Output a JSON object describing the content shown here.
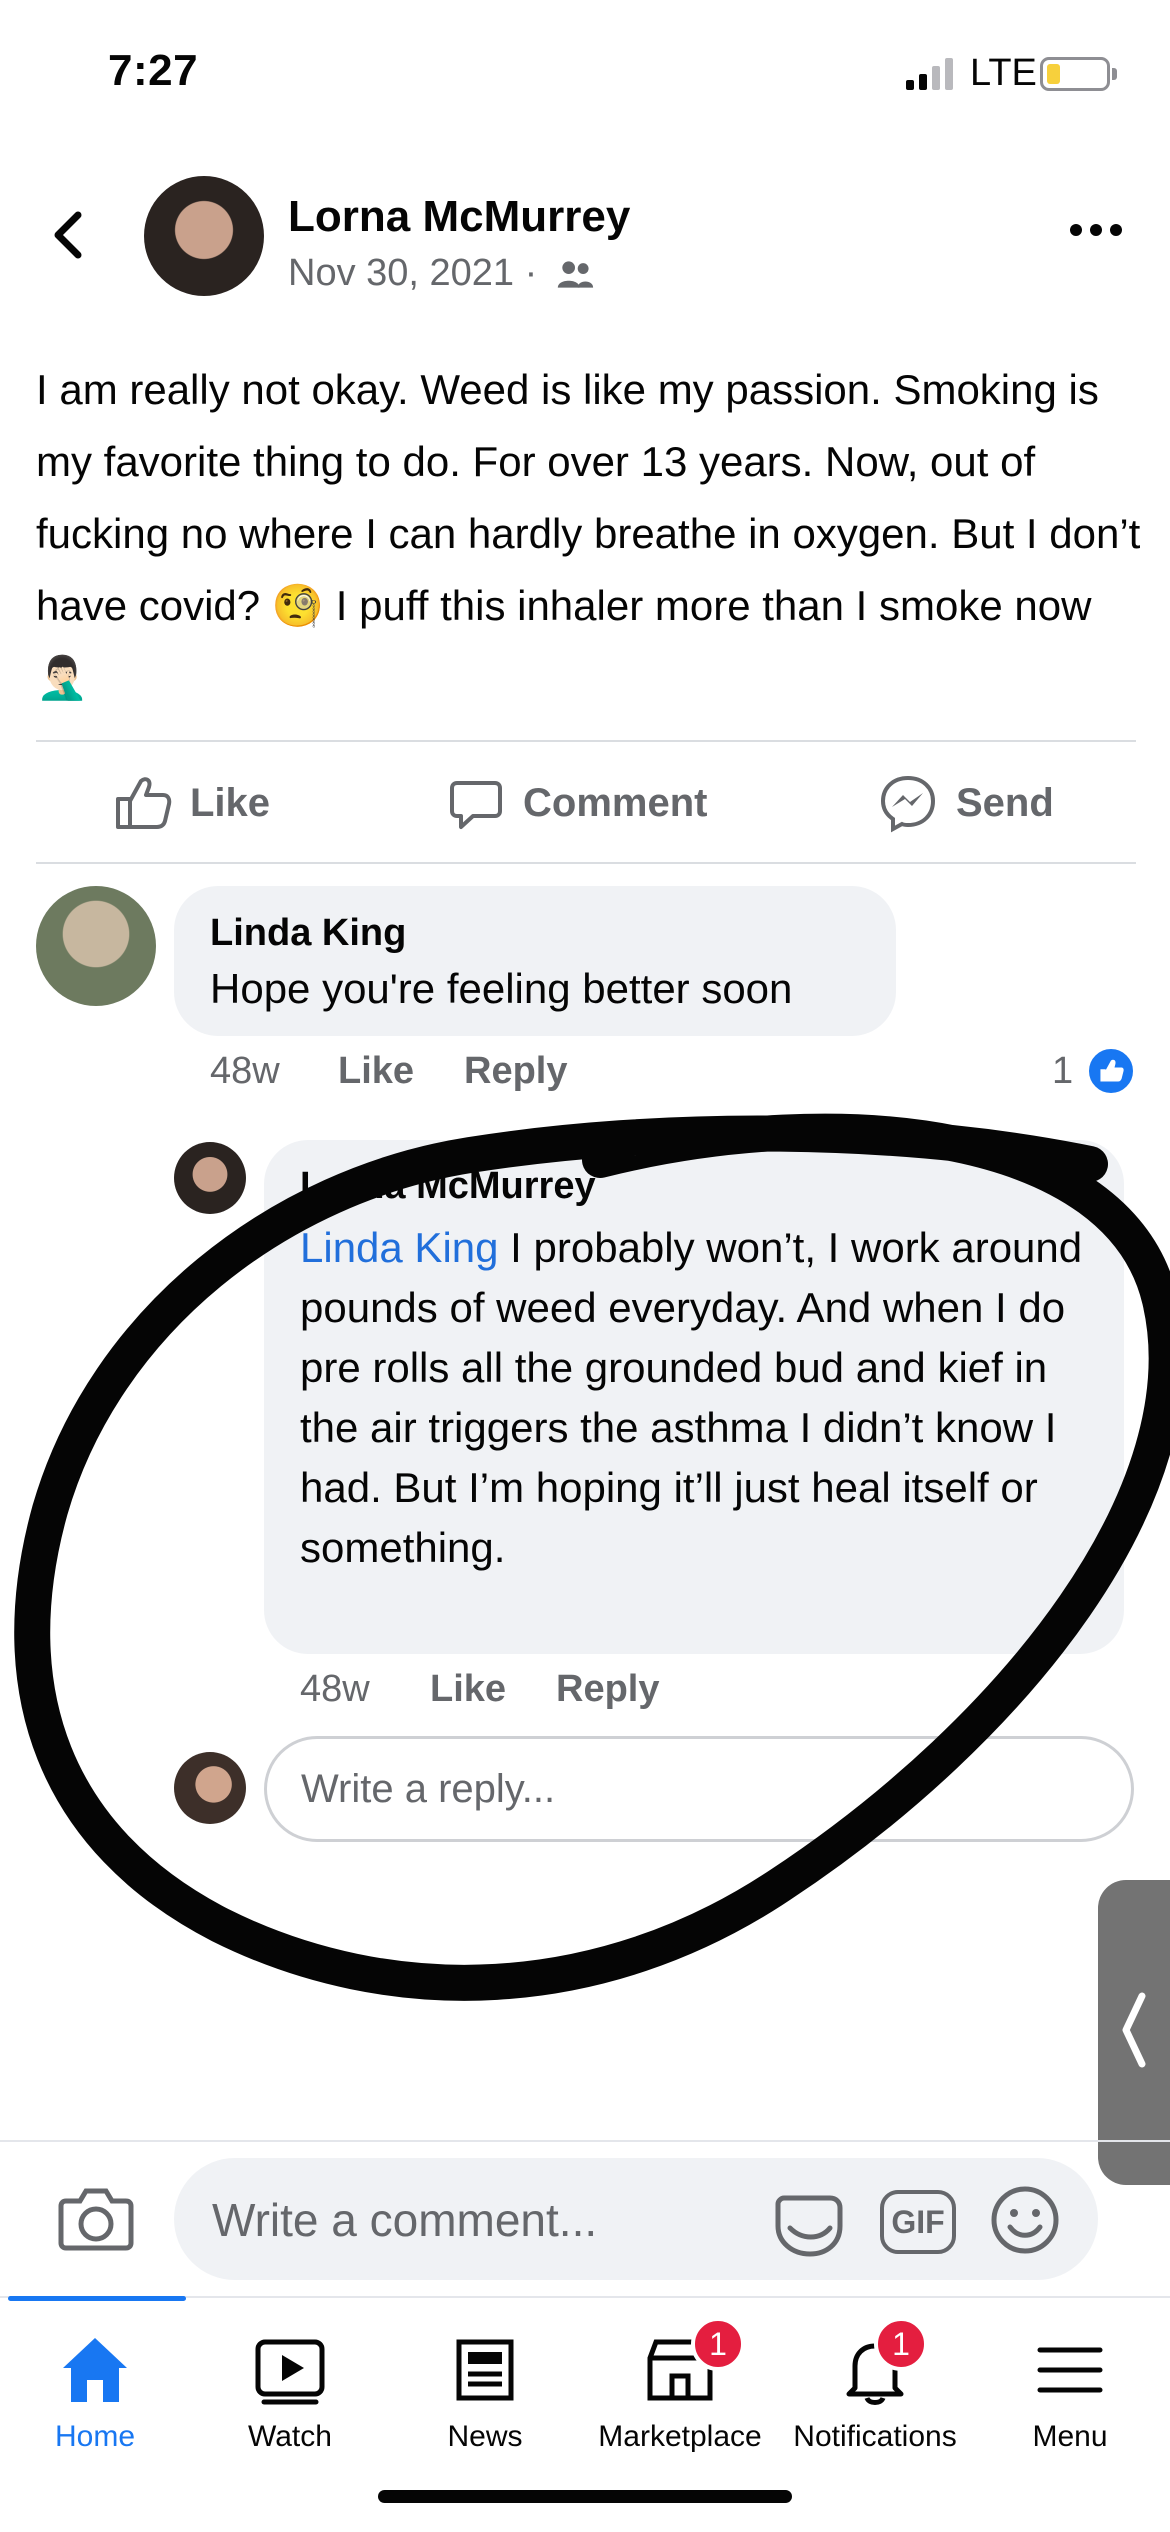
{
  "status_bar": {
    "time": "7:27",
    "network": "LTE",
    "battery_color": "#f7d03c"
  },
  "post": {
    "author": "Lorna McMurrey",
    "date": "Nov 30, 2021 ·",
    "audience_icon": "friends-icon",
    "text": "I am really not okay. Weed is like my passion. Smoking is my favorite thing to do. For over 13 years. Now, out of fucking no where I can hardly breathe in oxygen. But I don’t have covid? 🧐 I puff this inhaler more than I smoke now 🤦🏻‍♂️",
    "actions": {
      "like": "Like",
      "comment": "Comment",
      "send": "Send"
    }
  },
  "comments": [
    {
      "author": "Linda King",
      "text": "Hope you're feeling better soon",
      "time": "48w",
      "like": "Like",
      "reply": "Reply",
      "like_count": "1",
      "replies": [
        {
          "author": "Lorna McMurrey",
          "mention": "Linda King",
          "text": " I probably won’t, I work around pounds of weed everyday. And when I do pre rolls all the grounded bud and kief in the air triggers the asthma I didn’t know I had. But I’m hoping it’ll just heal itself or something.",
          "time": "48w",
          "like": "Like",
          "reply": "Reply"
        }
      ]
    }
  ],
  "reply_input": {
    "placeholder": "Write a reply..."
  },
  "composer": {
    "placeholder": "Write a comment...",
    "gif_label": "GIF"
  },
  "nav": {
    "items": [
      {
        "label": "Home",
        "icon": "home-icon",
        "active": true
      },
      {
        "label": "Watch",
        "icon": "watch-icon"
      },
      {
        "label": "News",
        "icon": "news-icon"
      },
      {
        "label": "Marketplace",
        "icon": "marketplace-icon",
        "badge": "1"
      },
      {
        "label": "Notifications",
        "icon": "bell-icon",
        "badge": "1"
      },
      {
        "label": "Menu",
        "icon": "menu-icon"
      }
    ]
  },
  "colors": {
    "facebook_blue": "#1877f2",
    "secondary_text": "#65676b",
    "bubble_background": "#f0f2f5",
    "badge_red": "#e41e3f"
  }
}
